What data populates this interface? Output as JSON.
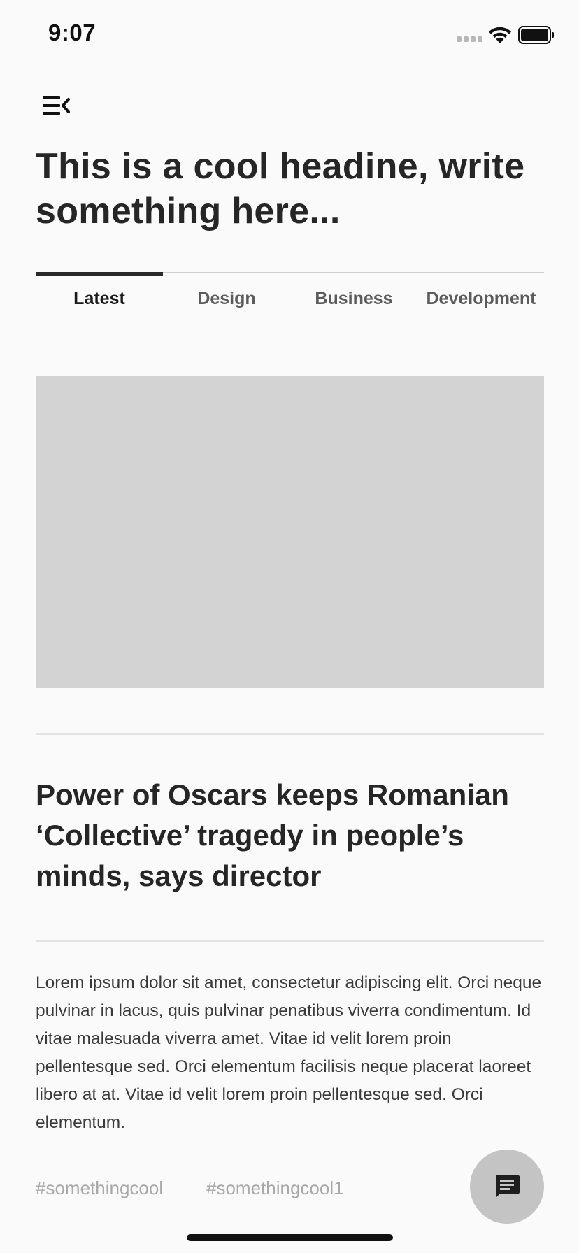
{
  "status_bar": {
    "time": "9:07",
    "icons": [
      "signal-icon",
      "wifi-icon",
      "battery-icon"
    ]
  },
  "header": {
    "menu_icon": "menu-collapse-icon",
    "headline": "This is a cool headine, write something here..."
  },
  "tabs": [
    {
      "label": "Latest",
      "active": true
    },
    {
      "label": "Design",
      "active": false
    },
    {
      "label": "Business",
      "active": false
    },
    {
      "label": "Development",
      "active": false
    }
  ],
  "article": {
    "image_color": "#d3d3d3",
    "title": "Power of Oscars keeps Romanian ‘Collective’ tragedy in people’s minds, says director",
    "body": "Lorem ipsum dolor sit amet, consectetur adipiscing elit. Orci neque pulvinar in lacus, quis pulvinar penatibus viverra condimentum. Id vitae malesuada viverra amet. Vitae id velit lorem proin pellentesque sed. Orci elementum facilisis neque placerat laoreet libero at at. Vitae id velit lorem proin pellentesque sed. Orci elementum.",
    "tags": [
      "#somethingcool",
      "#somethingcool1"
    ]
  },
  "fab": {
    "icon": "chat-icon",
    "color": "#c4c4c4"
  }
}
